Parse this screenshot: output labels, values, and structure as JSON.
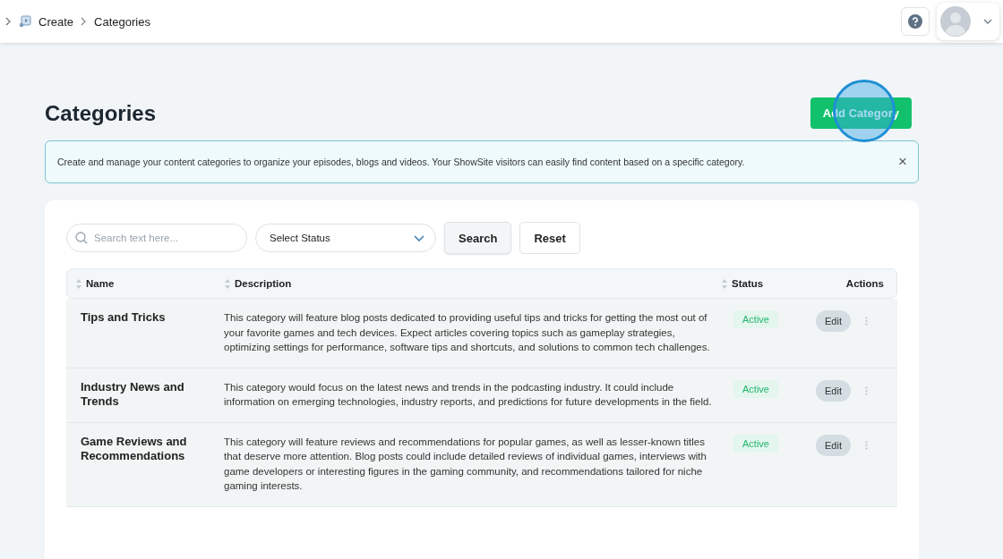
{
  "breadcrumb": [
    {
      "label": "Create"
    },
    {
      "label": "Categories"
    }
  ],
  "page": {
    "title": "Categories",
    "add_button": "Add Category"
  },
  "notice": {
    "text": "Create and manage your content categories to organize your episodes, blogs and videos. Your ShowSite visitors can easily find content based on a specific category.",
    "close": "×"
  },
  "filters": {
    "search_placeholder": "Search text here...",
    "status_select": "Select Status",
    "search_button": "Search",
    "reset_button": "Reset"
  },
  "table": {
    "columns": [
      {
        "label": "Name",
        "sortable": true
      },
      {
        "label": "Description",
        "sortable": true
      },
      {
        "label": "Status",
        "sortable": true
      },
      {
        "label": "Actions",
        "sortable": false
      }
    ],
    "rows": [
      {
        "name": "Tips and Tricks",
        "description": "This category will feature blog posts dedicated to providing useful tips and tricks for getting the most out of your favorite games and tech devices. Expect articles covering topics such as gameplay strategies, optimizing settings for performance, software tips and shortcuts, and solutions to common tech challenges.",
        "status": "Active",
        "kind": "active",
        "action": "Edit"
      },
      {
        "name": "Industry News and Trends",
        "description": "This category would focus on the latest news and trends in the podcasting industry. It could include information on emerging technologies, industry reports, and predictions for future developments in the field.",
        "status": "Active",
        "kind": "active",
        "action": "Edit"
      },
      {
        "name": "Game Reviews and Recommendations",
        "description": "This category will feature reviews and recommendations for popular games, as well as lesser-known titles that deserve more attention. Blog posts could include detailed reviews of individual games, interviews with game developers or interesting figures in the gaming community, and recommendations tailored for niche gaming interests.",
        "status": "Active",
        "kind": "active",
        "action": "Edit"
      }
    ]
  }
}
